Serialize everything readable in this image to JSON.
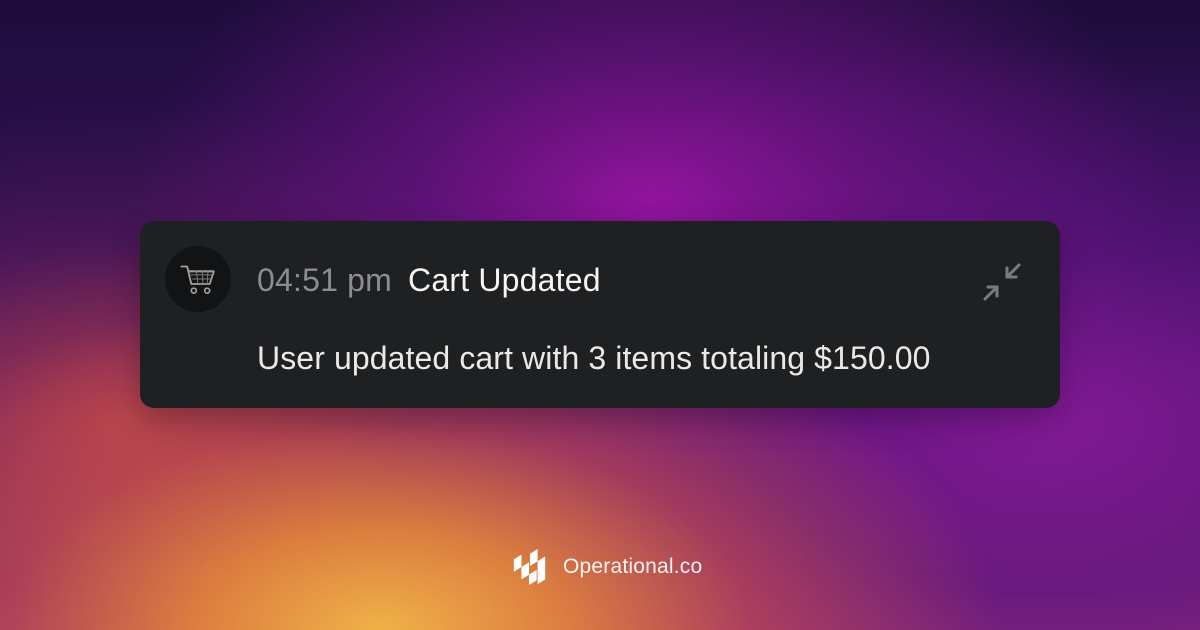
{
  "notification": {
    "icon": "shopping-cart-icon",
    "time": "04:51 pm",
    "title": "Cart Updated",
    "message": "User updated cart with 3 items totaling $150.00",
    "collapse_icon": "collapse-arrows-icon"
  },
  "brand": {
    "logo_icon": "operational-logo-icon",
    "name": "Operational.co"
  },
  "colors": {
    "card_background": "#1f2022",
    "avatar_background": "#121314",
    "time_text": "#8c8d91",
    "title_text": "#f5f5f6",
    "message_text": "#e9e9ea"
  }
}
